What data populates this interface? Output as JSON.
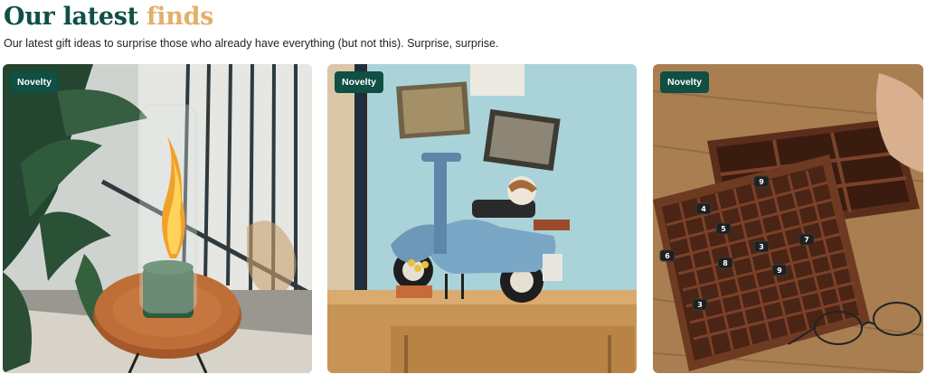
{
  "section": {
    "title_part1": "Our latest",
    "title_part2": "finds",
    "subtitle": "Our latest gift ideas to surprise those who already have everything (but not this). Surprise, surprise."
  },
  "cards": [
    {
      "badge": "Novelty",
      "image": "flame-lantern-on-side-table"
    },
    {
      "badge": "Novelty",
      "image": "toy-scooter-model-on-shelf"
    },
    {
      "badge": "Novelty",
      "image": "wooden-sudoku-board-game"
    }
  ],
  "colors": {
    "title_primary": "#0f4f44",
    "title_accent": "#e2b06a",
    "badge_bg": "#0f4f44",
    "badge_text": "#ffffff"
  }
}
